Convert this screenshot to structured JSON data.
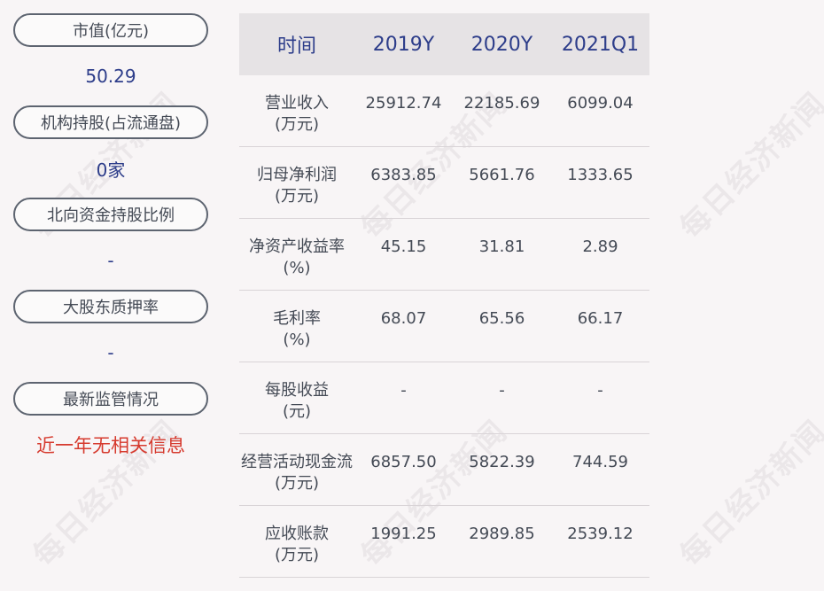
{
  "watermark": "每日经济新闻",
  "left_panel": [
    {
      "label": "市值(亿元)",
      "value": "50.29",
      "alert": false
    },
    {
      "label": "机构持股(占流通盘)",
      "value": "0家",
      "alert": false
    },
    {
      "label": "北向资金持股比例",
      "value": "-",
      "alert": false
    },
    {
      "label": "大股东质押率",
      "value": "-",
      "alert": false
    },
    {
      "label": "最新监管情况",
      "value": "近一年无相关信息",
      "alert": true
    }
  ],
  "table": {
    "headers": [
      "时间",
      "2019Y",
      "2020Y",
      "2021Q1"
    ],
    "rows": [
      {
        "label": "营业收入",
        "unit": "(万元)",
        "values": [
          "25912.74",
          "22185.69",
          "6099.04"
        ]
      },
      {
        "label": "归母净利润",
        "unit": "(万元)",
        "values": [
          "6383.85",
          "5661.76",
          "1333.65"
        ]
      },
      {
        "label": "净资产收益率",
        "unit": "(%)",
        "values": [
          "45.15",
          "31.81",
          "2.89"
        ]
      },
      {
        "label": "毛利率",
        "unit": "(%)",
        "values": [
          "68.07",
          "65.56",
          "66.17"
        ]
      },
      {
        "label": "每股收益",
        "unit": "(元)",
        "values": [
          "-",
          "-",
          "-"
        ]
      },
      {
        "label": "经营活动现金流",
        "unit": "(万元)",
        "values": [
          "6857.50",
          "5822.39",
          "744.59"
        ]
      },
      {
        "label": "应收账款",
        "unit": "(万元)",
        "values": [
          "1991.25",
          "2989.85",
          "2539.12"
        ]
      }
    ]
  }
}
